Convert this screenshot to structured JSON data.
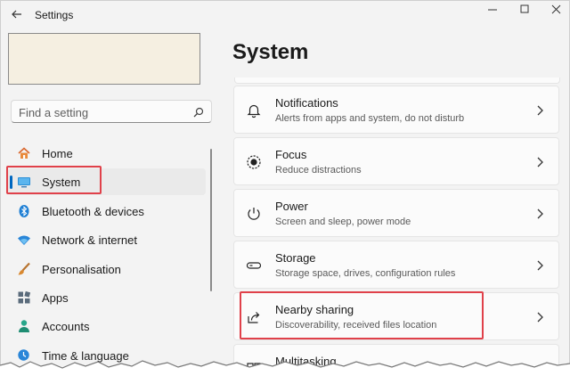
{
  "window": {
    "title": "Settings",
    "controls": [
      "minimize-icon",
      "maximize-icon",
      "close-icon"
    ]
  },
  "search": {
    "placeholder": "Find a setting",
    "icon": "search-icon"
  },
  "sidebar": {
    "items": [
      {
        "label": "Home",
        "icon": "home-icon",
        "active": false
      },
      {
        "label": "System",
        "icon": "monitor-icon",
        "active": true
      },
      {
        "label": "Bluetooth & devices",
        "icon": "bluetooth-icon",
        "active": false
      },
      {
        "label": "Network & internet",
        "icon": "wifi-icon",
        "active": false
      },
      {
        "label": "Personalisation",
        "icon": "brush-icon",
        "active": false
      },
      {
        "label": "Apps",
        "icon": "apps-icon",
        "active": false
      },
      {
        "label": "Accounts",
        "icon": "person-icon",
        "active": false
      },
      {
        "label": "Time & language",
        "icon": "globe-clock-icon",
        "active": false
      }
    ]
  },
  "main": {
    "title": "System",
    "cards": [
      {
        "title": "Notifications",
        "subtitle": "Alerts from apps and system, do not disturb",
        "icon": "bell-icon"
      },
      {
        "title": "Focus",
        "subtitle": "Reduce distractions",
        "icon": "focus-icon"
      },
      {
        "title": "Power",
        "subtitle": "Screen and sleep, power mode",
        "icon": "power-icon"
      },
      {
        "title": "Storage",
        "subtitle": "Storage space, drives, configuration rules",
        "icon": "storage-icon"
      },
      {
        "title": "Nearby sharing",
        "subtitle": "Discoverability, received files location",
        "icon": "share-icon"
      },
      {
        "title": "Multitasking",
        "subtitle": "",
        "icon": "multitask-icon"
      }
    ]
  },
  "colors": {
    "accent": "#0067c0",
    "highlight": "#e0414a"
  }
}
